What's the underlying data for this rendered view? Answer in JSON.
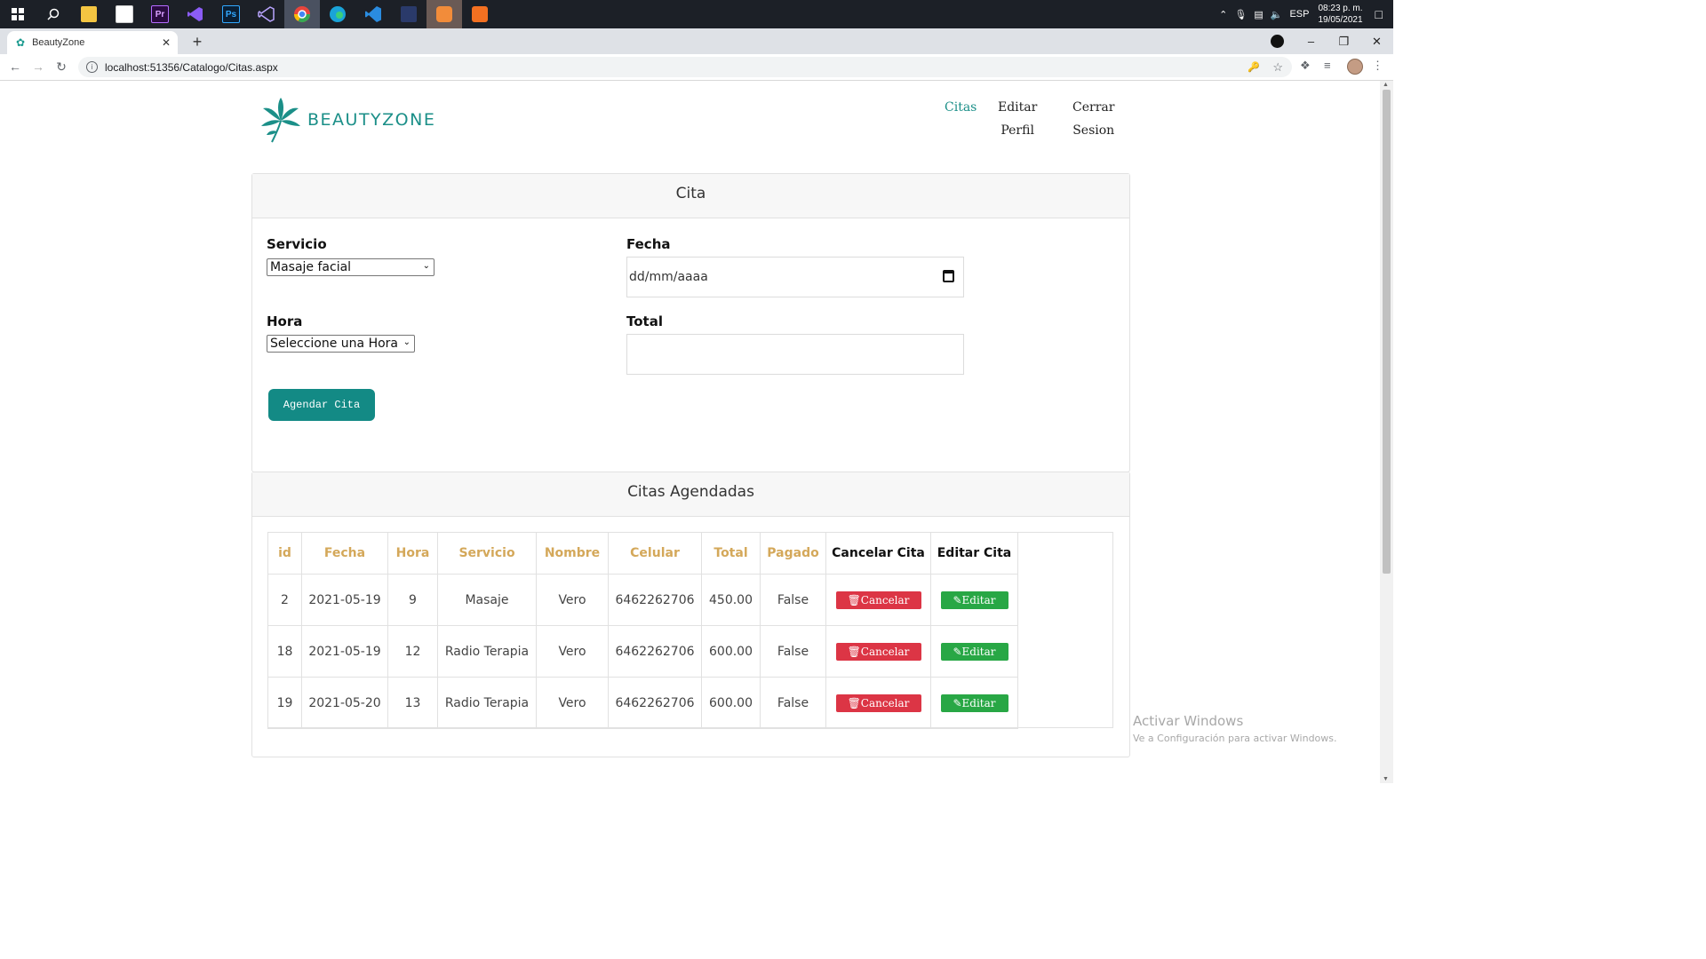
{
  "taskbar": {
    "apps": [
      {
        "icon": "windows-start-icon",
        "color": "#ffffff"
      },
      {
        "icon": "search-icon",
        "color": "#ffffff"
      },
      {
        "icon": "file-explorer-icon",
        "color": "#f4c542"
      },
      {
        "icon": "store-icon",
        "color": "#ffffff"
      },
      {
        "icon": "premiere-icon",
        "color": "#2a0b40",
        "text": "Pr"
      },
      {
        "icon": "visual-studio-icon",
        "color": "#8b5cf6"
      },
      {
        "icon": "photoshop-icon",
        "color": "#0a1f35",
        "text": "Ps"
      },
      {
        "icon": "visual-studio-2-icon",
        "color": "#7c5cd6"
      },
      {
        "icon": "chrome-icon",
        "color": "#e8453c"
      },
      {
        "icon": "edge-icon",
        "color": "#1aa3d8"
      },
      {
        "icon": "vscode-icon",
        "color": "#2a8ce0"
      },
      {
        "icon": "game-icon",
        "color": "#2a3a6a"
      },
      {
        "icon": "discord-icon",
        "color": "#f28c3a"
      },
      {
        "icon": "xampp-icon",
        "color": "#f37021"
      }
    ],
    "tray": {
      "language": "ESP",
      "time": "08:23 p. m.",
      "date": "19/05/2021"
    }
  },
  "browser": {
    "tab_title": "BeautyZone",
    "url": "localhost:51356/Catalogo/Citas.aspx"
  },
  "page": {
    "brand": "BEAUTYZONE",
    "nav": [
      {
        "line1": "Citas",
        "line2": ""
      },
      {
        "line1": "Editar",
        "line2": "Perfil"
      },
      {
        "line1": "Cerrar",
        "line2": "Sesion"
      }
    ],
    "form": {
      "header": "Cita",
      "servicio_label": "Servicio",
      "servicio_value": "Masaje facial",
      "fecha_label": "Fecha",
      "fecha_placeholder": "dd/mm/aaaa",
      "hora_label": "Hora",
      "hora_value": "Seleccione una Hora",
      "total_label": "Total",
      "total_value": "",
      "submit_label": "Agendar Cita"
    },
    "appointments": {
      "header": "Citas Agendadas",
      "columns": [
        "id",
        "Fecha",
        "Hora",
        "Servicio",
        "Nombre",
        "Celular",
        "Total",
        "Pagado",
        "Cancelar Cita",
        "Editar Cita"
      ],
      "rows": [
        {
          "id": "2",
          "fecha": "2021-05-19",
          "hora": "9",
          "servicio": "Masaje",
          "nombre": "Vero",
          "celular": "6462262706",
          "total": "450.00",
          "pagado": "False"
        },
        {
          "id": "18",
          "fecha": "2021-05-19",
          "hora": "12",
          "servicio": "Radio Terapia",
          "nombre": "Vero",
          "celular": "6462262706",
          "total": "600.00",
          "pagado": "False"
        },
        {
          "id": "19",
          "fecha": "2021-05-20",
          "hora": "13",
          "servicio": "Radio Terapia",
          "nombre": "Vero",
          "celular": "6462262706",
          "total": "600.00",
          "pagado": "False"
        }
      ],
      "cancel_label": "Cancelar",
      "edit_label": "Editar"
    }
  },
  "watermark": {
    "line1": "Activar Windows",
    "line2": "Ve a Configuración para activar Windows."
  },
  "colors": {
    "brand": "#1b8f88",
    "header_gold": "#d4a85a",
    "cancel_red": "#dc3545",
    "edit_green": "#28a745"
  }
}
